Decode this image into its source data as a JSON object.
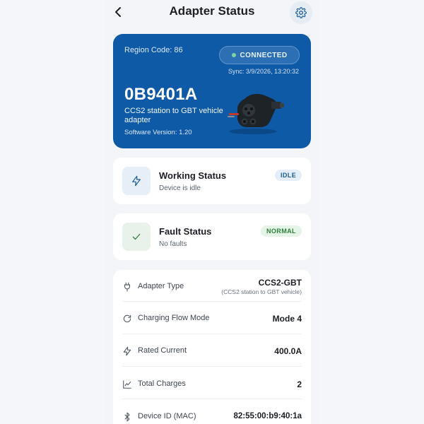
{
  "header": {
    "title": "Adapter Status"
  },
  "hero": {
    "region_code": "Region Code: 86",
    "connection_status": "CONNECTED",
    "sync": "Sync: 3/9/2026, 13:20:32",
    "adapter_id": "0B9401A",
    "description": "CCS2 station to GBT vehicle adapter",
    "software_version": "Software Version: 1.20"
  },
  "working_status": {
    "title": "Working Status",
    "subtitle": "Device is idle",
    "badge": "IDLE"
  },
  "fault_status": {
    "title": "Fault Status",
    "subtitle": "No faults",
    "badge": "NORMAL"
  },
  "details": [
    {
      "icon": "plug-icon",
      "label": "Adapter Type",
      "value": "CCS2-GBT",
      "sub": "(CCS2 station to GBT vehicle)"
    },
    {
      "icon": "refresh-icon",
      "label": "Charging Flow Mode",
      "value": "Mode 4"
    },
    {
      "icon": "bolt-icon",
      "label": "Rated Current",
      "value": "400.0A"
    },
    {
      "icon": "chart-icon",
      "label": "Total Charges",
      "value": "2"
    },
    {
      "icon": "bluetooth-icon",
      "label": "Device ID (MAC)",
      "value": "82:55:00:b9:40:1a"
    }
  ],
  "colors": {
    "hero_bg": "#0f5aa6",
    "idle_badge_bg": "#e3eef9",
    "idle_badge_fg": "#1b5d9c",
    "normal_badge_bg": "#e4f4e7",
    "normal_badge_fg": "#2e7d3e"
  }
}
